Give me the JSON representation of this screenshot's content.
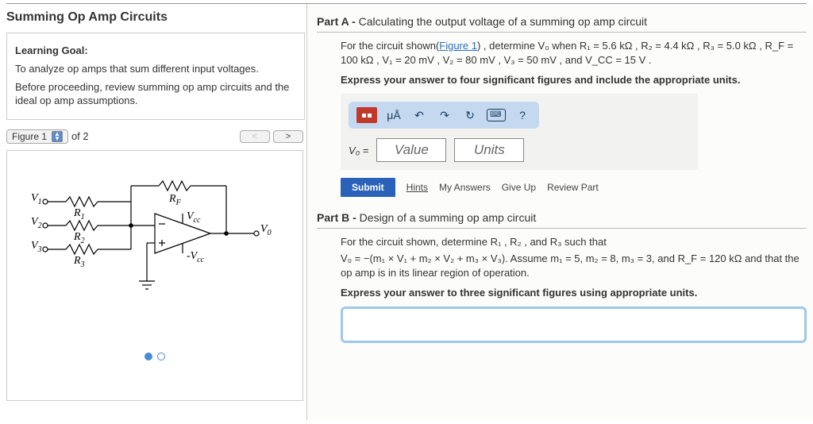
{
  "left": {
    "title": "Summing Op Amp Circuits",
    "goal_label": "Learning Goal:",
    "goal_text": "To analyze op amps that sum different input voltages.",
    "goal_text2": "Before proceeding, review summing op amp circuits and the ideal op amp assumptions.",
    "figure_label": "Figure 1",
    "figure_count": "of 2",
    "nav_prev": "<",
    "nav_next": ">",
    "circuit": {
      "V1": "V",
      "V1sub": "1",
      "V2": "V",
      "V2sub": "2",
      "V3": "V",
      "V3sub": "3",
      "R1": "R",
      "R1sub": "1",
      "R2": "R",
      "R2sub": "2",
      "R3": "R",
      "R3sub": "3",
      "RF": "R",
      "RFsub": "F",
      "Vcc": "V",
      "Vccsub": "cc",
      "mVcc": "-V",
      "mVccsub": "cc",
      "Vo": "V",
      "Vosub": "0"
    }
  },
  "partA": {
    "header_bold": "Part A -",
    "header_rest": " Calculating the output voltage of a summing op amp circuit",
    "prompt_before": "For the circuit shown(",
    "fig_link": "Figure 1",
    "prompt_after": ") , determine V₀ when R₁ = 5.6 kΩ , R₂ = 4.4 kΩ , R₃ = 5.0 kΩ , R_F = 100 kΩ , V₁ = 20 mV , V₂ = 80 mV , V₃ = 50 mV , and V_CC = 15 V .",
    "express": "Express your answer to four significant figures and include the appropriate units.",
    "toolbar": {
      "ua": "μÅ",
      "undo": "↶",
      "redo": "↷",
      "reset": "↻",
      "help": "?"
    },
    "answer_label": "V₀ =",
    "value_ph": "Value",
    "units_ph": "Units",
    "submit": "Submit",
    "hints": "Hints",
    "my_answers": "My Answers",
    "give_up": "Give Up",
    "review": "Review Part"
  },
  "partB": {
    "header_bold": "Part B -",
    "header_rest": " Design of a summing op amp circuit",
    "line1": "For the circuit shown, determine R₁ , R₂ , and R₃ such that",
    "line2": "V₀ = −(m₁ × V₁ + m₂ × V₂ + m₃ × V₃). Assume m₁ = 5, m₂ = 8, m₃ = 3, and R_F = 120 kΩ and that the op amp is in its linear region of operation.",
    "express": "Express your answer to three significant figures using appropriate units."
  }
}
